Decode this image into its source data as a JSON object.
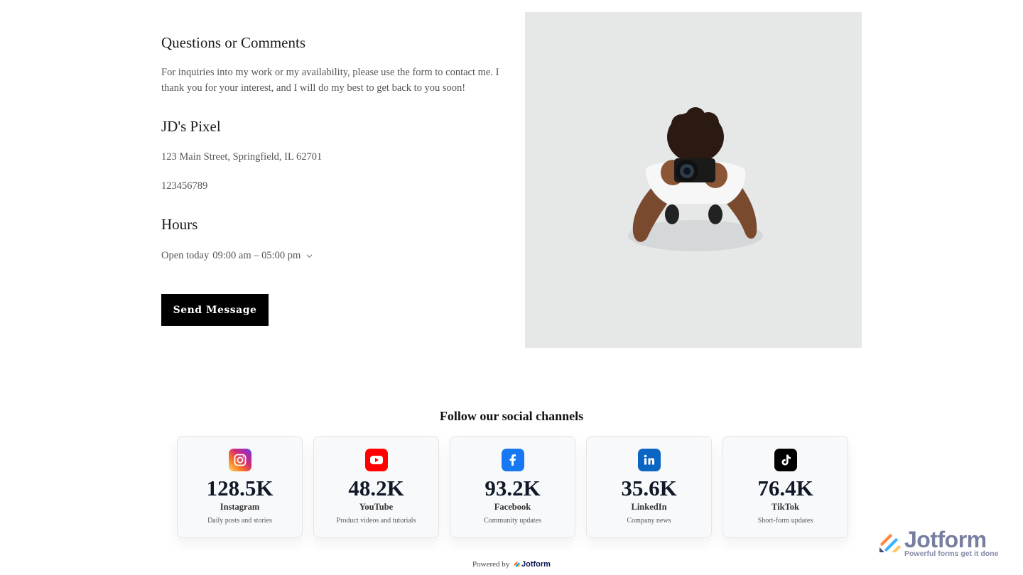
{
  "contact": {
    "questions_heading": "Questions or Comments",
    "questions_text": "For inquiries into my work or my availability, please use the form to contact me. I thank you for your interest, and I will do my best to get back to you soon!",
    "business_name": "JD's Pixel",
    "address": "123 Main Street, Springfield, IL 62701",
    "phone": "123456789",
    "hours_heading": "Hours",
    "hours_status": "Open today",
    "hours_range": "09:00 am – 05:00 pm",
    "send_button": "Send Message"
  },
  "social": {
    "title": "Follow our social channels",
    "channels": [
      {
        "count": "128.5K",
        "name": "Instagram",
        "desc": "Daily posts and stories",
        "icon": "instagram-icon"
      },
      {
        "count": "48.2K",
        "name": "YouTube",
        "desc": "Product videos and tutorials",
        "icon": "youtube-icon"
      },
      {
        "count": "93.2K",
        "name": "Facebook",
        "desc": "Community updates",
        "icon": "facebook-icon"
      },
      {
        "count": "35.6K",
        "name": "LinkedIn",
        "desc": "Company news",
        "icon": "linkedin-icon"
      },
      {
        "count": "76.4K",
        "name": "TikTok",
        "desc": "Short-form updates",
        "icon": "tiktok-icon"
      }
    ]
  },
  "footer": {
    "powered_by": "Powered by",
    "brand": "Jotform"
  },
  "badge": {
    "brand": "Jotform",
    "tagline": "Powerful forms get it done"
  },
  "colors": {
    "button_bg": "#000000",
    "photo_bg": "#e6e8e8",
    "youtube": "#ff0000",
    "facebook": "#1877f2",
    "linkedin": "#0a66c2",
    "tiktok": "#000000"
  }
}
